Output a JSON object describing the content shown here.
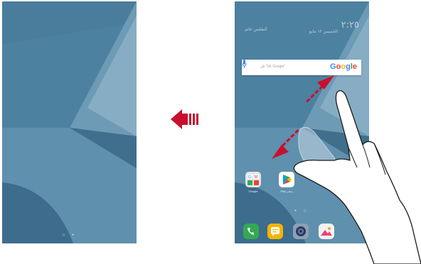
{
  "left_screen": {
    "page_indicator": "○ •"
  },
  "right_screen": {
    "status": {
      "time": "٢:٢٥",
      "date": "الخميس ١٢ مايو",
      "weather": "الطقس غائم"
    },
    "search_widget": {
      "hint": "قل \"Ok Google\"",
      "logo": "Google",
      "logo_colors": [
        "#4285F4",
        "#EA4335",
        "#FBBC05",
        "#4285F4",
        "#34A853",
        "#EA4335"
      ]
    },
    "apps": [
      {
        "name": "google-folder",
        "label": "Google"
      },
      {
        "name": "play-store",
        "label": "Play متجر"
      }
    ],
    "page_indicator": "• ○",
    "dock": [
      {
        "name": "phone-app",
        "color": "#34a853"
      },
      {
        "name": "messages-app",
        "color": "#f5b400"
      },
      {
        "name": "camera-app",
        "color": "#5a6b8c"
      },
      {
        "name": "gallery-app",
        "color": "#e8457a"
      }
    ]
  },
  "gesture": {
    "direction": "swipe-left",
    "arrow_color": "#c8102e"
  }
}
